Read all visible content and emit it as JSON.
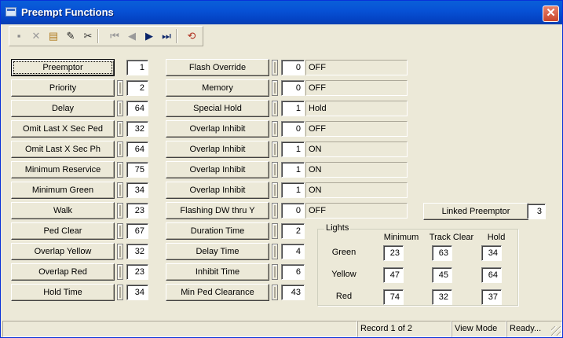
{
  "window": {
    "title": "Preempt Functions",
    "close_symbol": "✕"
  },
  "toolbar": [
    {
      "name": "save-icon",
      "glyph": "▪"
    },
    {
      "name": "delete-icon",
      "glyph": "✕"
    },
    {
      "name": "books-icon",
      "glyph": "▤"
    },
    {
      "name": "pencil-icon",
      "glyph": "✎"
    },
    {
      "name": "scissors-icon",
      "glyph": "✂"
    },
    {
      "name": "first-record-icon",
      "glyph": "⏮"
    },
    {
      "name": "previous-record-icon",
      "glyph": "◀"
    },
    {
      "name": "next-record-icon",
      "glyph": "▶"
    },
    {
      "name": "last-record-icon",
      "glyph": "⏭"
    },
    {
      "name": "refresh-icon",
      "glyph": "⟲"
    }
  ],
  "left": [
    {
      "label": "Preemptor",
      "value": "1"
    },
    {
      "label": "Priority",
      "value": "2"
    },
    {
      "label": "Delay",
      "value": "64"
    },
    {
      "label": "Omit Last X Sec Ped",
      "value": "32"
    },
    {
      "label": "Omit Last X Sec Ph",
      "value": "64"
    },
    {
      "label": "Minimum Reservice",
      "value": "75"
    },
    {
      "label": "Minimum Green",
      "value": "34"
    },
    {
      "label": "Walk",
      "value": "23"
    },
    {
      "label": "Ped Clear",
      "value": "67"
    },
    {
      "label": "Overlap Yellow",
      "value": "32"
    },
    {
      "label": "Overlap Red",
      "value": "23"
    },
    {
      "label": "Hold Time",
      "value": "34"
    }
  ],
  "middle": [
    {
      "label": "Flash Override",
      "value": "0",
      "text": "OFF"
    },
    {
      "label": "Memory",
      "value": "0",
      "text": "OFF"
    },
    {
      "label": "Special Hold",
      "value": "1",
      "text": "Hold"
    },
    {
      "label": "Overlap Inhibit",
      "value": "0",
      "text": "OFF"
    },
    {
      "label": "Overlap Inhibit",
      "value": "1",
      "text": "ON"
    },
    {
      "label": "Overlap Inhibit",
      "value": "1",
      "text": "ON"
    },
    {
      "label": "Overlap Inhibit",
      "value": "1",
      "text": "ON"
    },
    {
      "label": "Flashing DW thru Y",
      "value": "0",
      "text": "OFF"
    },
    {
      "label": "Duration Time",
      "value": "2"
    },
    {
      "label": "Delay Time",
      "value": "4"
    },
    {
      "label": "Inhibit Time",
      "value": "6"
    },
    {
      "label": "Min Ped Clearance",
      "value": "43"
    }
  ],
  "linked": {
    "label": "Linked Preemptor",
    "value": "3"
  },
  "lights": {
    "title": "Lights",
    "columns": [
      "Minimum",
      "Track Clear",
      "Hold"
    ],
    "rows": [
      {
        "label": "Green",
        "values": [
          "23",
          "63",
          "34"
        ]
      },
      {
        "label": "Yellow",
        "values": [
          "47",
          "45",
          "64"
        ]
      },
      {
        "label": "Red",
        "values": [
          "74",
          "32",
          "37"
        ]
      }
    ]
  },
  "status": {
    "record": "Record 1 of 2",
    "mode": "View Mode",
    "state": "Ready..."
  }
}
